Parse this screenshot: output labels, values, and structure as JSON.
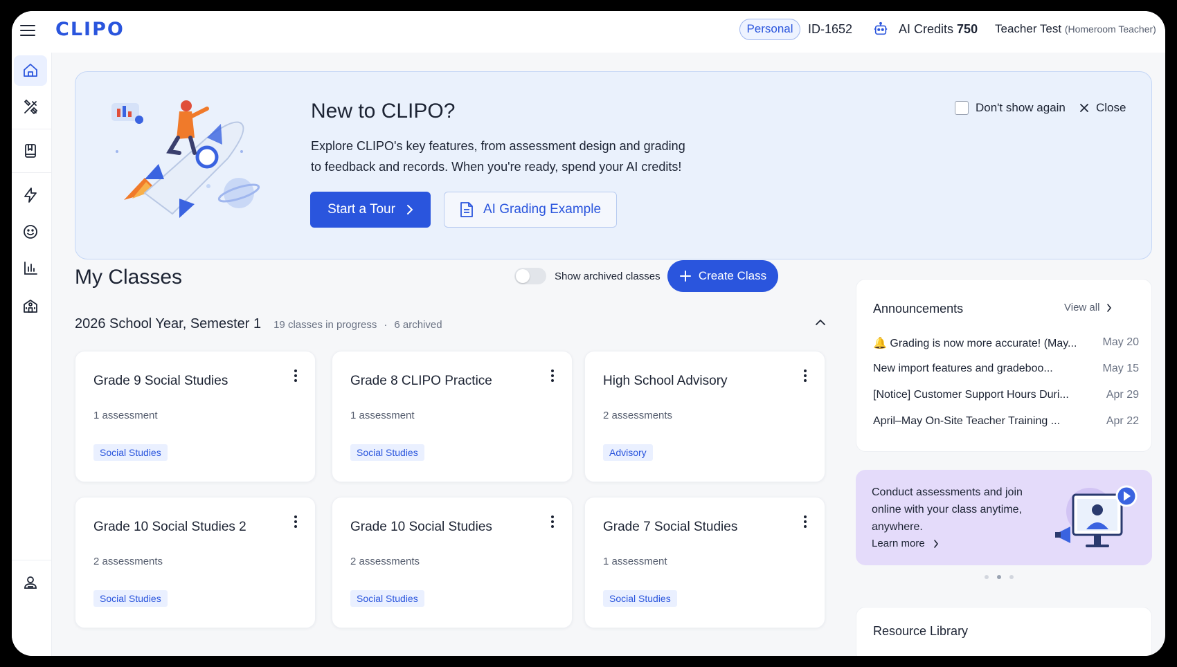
{
  "app": {
    "logo": "CLIPO"
  },
  "header": {
    "account_type": "Personal",
    "user_id": "ID-1652",
    "credits_label": "AI Credits",
    "credits_value": "750",
    "teacher_name": "Teacher Test",
    "teacher_role": "(Homeroom Teacher)"
  },
  "sidebar": {
    "items": [
      {
        "icon": "home-icon",
        "active": true
      },
      {
        "icon": "tools-icon"
      },
      {
        "icon": "bookmark-book-icon"
      },
      {
        "icon": "lightning-icon"
      },
      {
        "icon": "smiley-icon"
      },
      {
        "icon": "bar-chart-icon"
      },
      {
        "icon": "school-building-icon"
      },
      {
        "icon": "user-profile-icon"
      }
    ]
  },
  "banner": {
    "title": "New to CLIPO?",
    "description": "Explore CLIPO's key features, from assessment design and grading to feedback and records. When you're ready, spend your AI credits!",
    "primary_button": "Start a Tour",
    "secondary_button": "AI Grading Example",
    "dont_show": "Don't show again",
    "close": "Close"
  },
  "classes": {
    "title": "My Classes",
    "toggle_label": "Show archived classes",
    "create_button": "Create Class",
    "semester": "2026 School Year, Semester 1",
    "in_progress": "19 classes in progress",
    "separator": "·",
    "archived": "6 archived",
    "cards": [
      {
        "title": "Grade 9 Social Studies",
        "count": "1 assessment",
        "tag": "Social Studies"
      },
      {
        "title": "Grade 8 CLIPO Practice",
        "count": "1 assessment",
        "tag": "Social Studies"
      },
      {
        "title": "High School Advisory",
        "count": "2 assessments",
        "tag": "Advisory"
      },
      {
        "title": "Grade 10 Social Studies 2",
        "count": "2 assessments",
        "tag": "Social Studies"
      },
      {
        "title": "Grade 10 Social Studies",
        "count": "2 assessments",
        "tag": "Social Studies"
      },
      {
        "title": "Grade 7 Social Studies",
        "count": "1 assessment",
        "tag": "Social Studies"
      }
    ]
  },
  "announcements": {
    "title": "Announcements",
    "view_all": "View all",
    "items": [
      {
        "text": "🔔 Grading is now more accurate! (May...",
        "date": "May 20"
      },
      {
        "text": "New import features and gradeboo...",
        "date": "May 15"
      },
      {
        "text": "[Notice] Customer Support Hours Duri...",
        "date": "Apr 29"
      },
      {
        "text": "April–May On-Site Teacher Training ...",
        "date": "Apr 22"
      }
    ]
  },
  "promo": {
    "text": "Conduct assessments and join online with your class anytime, anywhere.",
    "link": "Learn more",
    "active_slide": 2,
    "slides": 3
  },
  "resources": {
    "title": "Resource Library"
  },
  "colors": {
    "accent": "#2a55dd",
    "banner_bg": "#eaf1fc",
    "promo_bg": "#e4dbfa",
    "tag_bg": "#eaf0ff"
  }
}
